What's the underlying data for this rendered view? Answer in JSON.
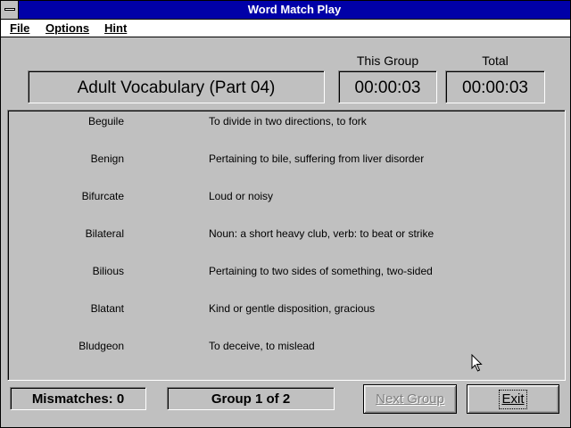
{
  "window": {
    "title": "Word Match Play"
  },
  "menu": {
    "file": "File",
    "options": "Options",
    "hint": "Hint"
  },
  "header": {
    "group_title": "Adult Vocabulary (Part 04)",
    "this_group_label": "This Group",
    "this_group_time": "00:00:03",
    "total_label": "Total",
    "total_time": "00:00:03"
  },
  "words": [
    {
      "term": "Beguile",
      "definition": "To divide in two directions, to fork"
    },
    {
      "term": "Benign",
      "definition": "Pertaining to bile, suffering from liver disorder"
    },
    {
      "term": "Bifurcate",
      "definition": "Loud or noisy"
    },
    {
      "term": "Bilateral",
      "definition": "Noun: a short heavy club, verb: to beat or strike"
    },
    {
      "term": "Bilious",
      "definition": "Pertaining to two sides of something, two-sided"
    },
    {
      "term": "Blatant",
      "definition": "Kind or gentle disposition, gracious"
    },
    {
      "term": "Bludgeon",
      "definition": "To deceive, to mislead"
    }
  ],
  "footer": {
    "mismatches": "Mismatches: 0",
    "group": "Group 1 of 2",
    "next_group": "Next Group",
    "exit": "Exit"
  },
  "colors": {
    "titlebar": "#0000a8",
    "face": "#c0c0c0",
    "disabled_text": "#808080"
  },
  "icons": {
    "system_menu": "system-menu-icon",
    "cursor": "mouse-pointer-icon"
  }
}
